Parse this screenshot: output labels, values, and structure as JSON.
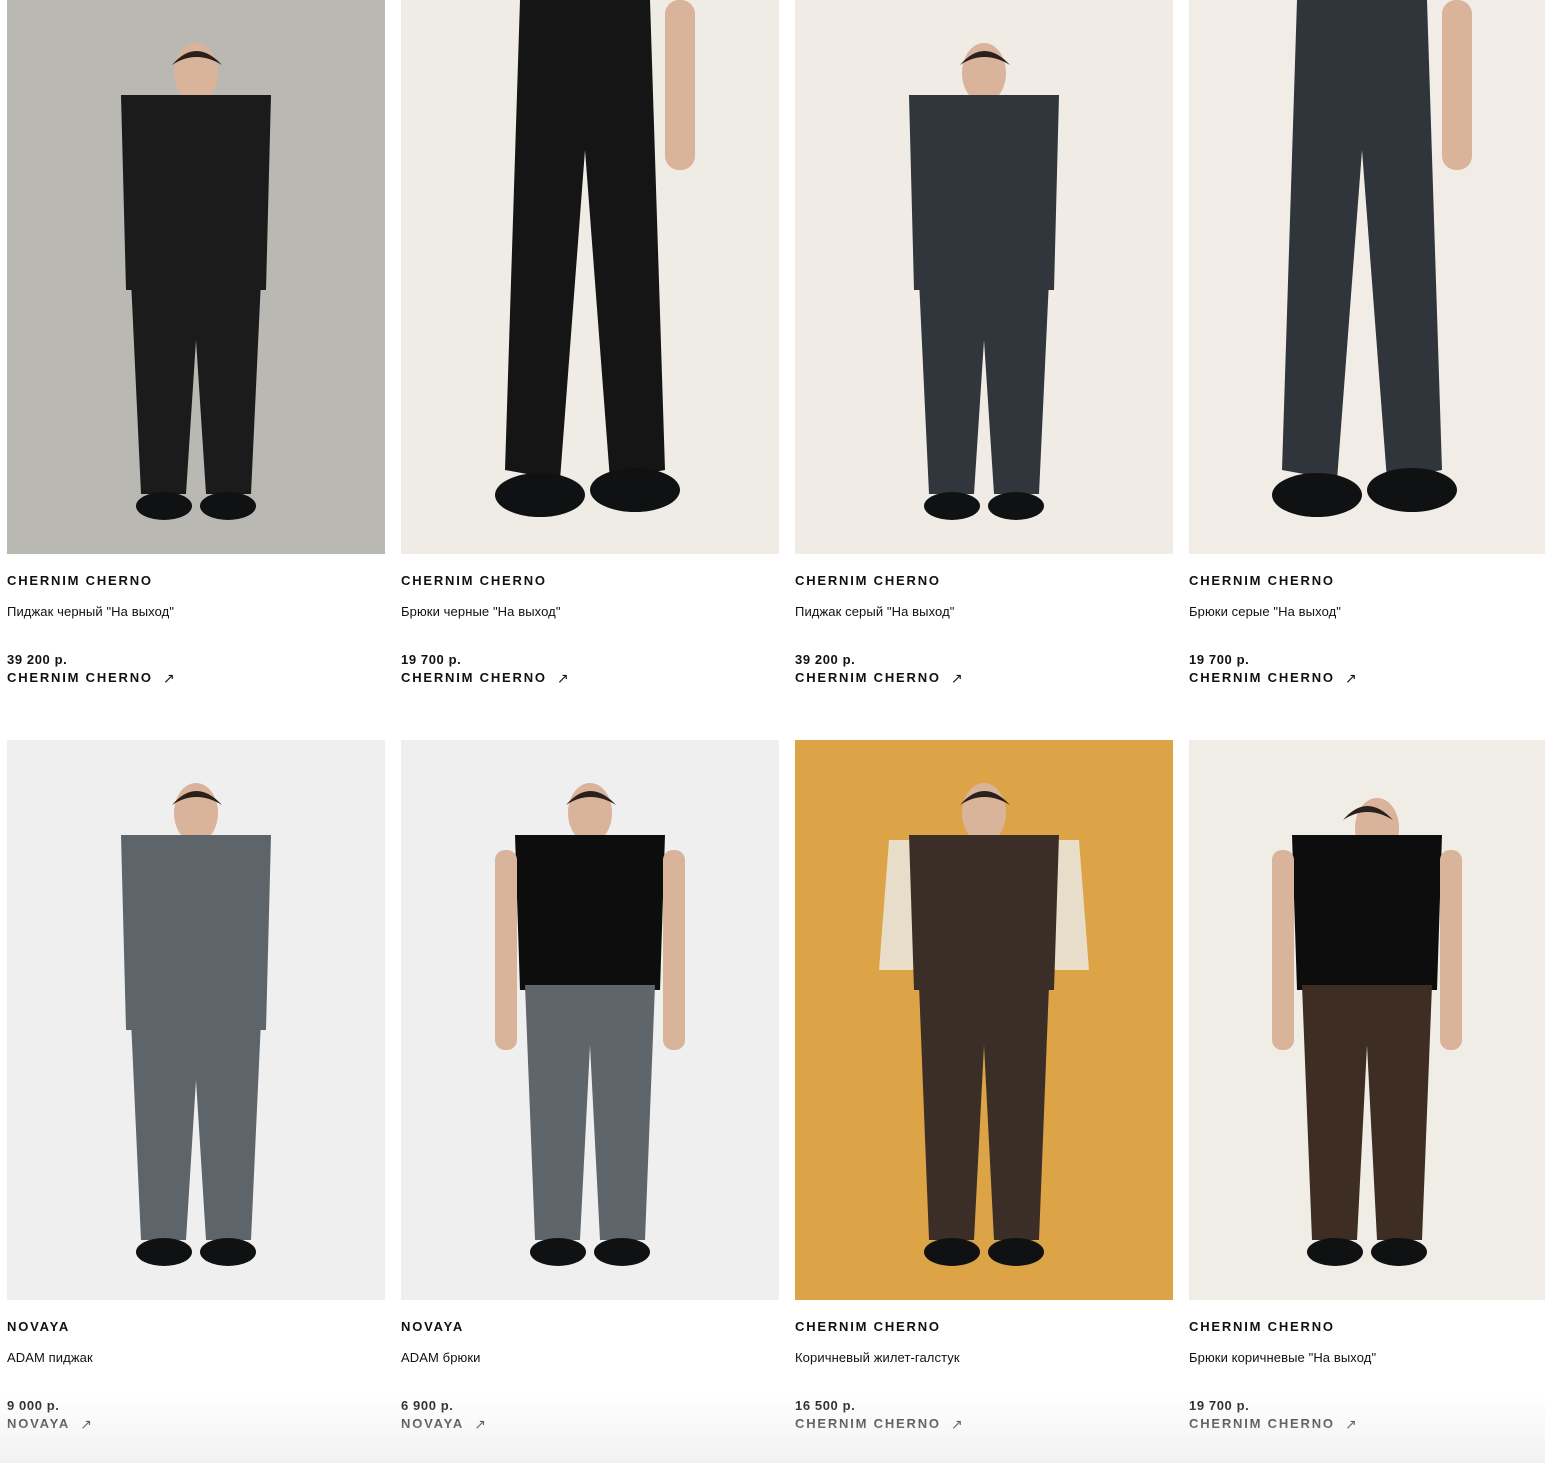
{
  "products": [
    {
      "brand": "CHERNIM CHERNO",
      "title": "Пиджак черный \"На выход\"",
      "price": "39 200 р.",
      "shop": "CHERNIM CHERNO",
      "bg": "#b9b8b2",
      "garment": "#1b1b1c",
      "kind": "full-suit"
    },
    {
      "brand": "CHERNIM CHERNO",
      "title": "Брюки черные \"На выход\"",
      "price": "19 700 р.",
      "shop": "CHERNIM CHERNO",
      "bg": "#efece6",
      "garment": "#151516",
      "kind": "pants"
    },
    {
      "brand": "CHERNIM CHERNO",
      "title": "Пиджак серый \"На выход\"",
      "price": "39 200 р.",
      "shop": "CHERNIM CHERNO",
      "bg": "#f0ece5",
      "garment": "#30363c",
      "kind": "full-suit"
    },
    {
      "brand": "CHERNIM CHERNO",
      "title": "Брюки серые \"На выход\"",
      "price": "19 700 р.",
      "shop": "CHERNIM CHERNO",
      "bg": "#f1ede6",
      "garment": "#2f353b",
      "kind": "pants"
    },
    {
      "brand": "NOVAYA",
      "title": "ADAM пиджак",
      "price": "9 000 р.",
      "shop": "NOVAYA",
      "bg": "#efefef",
      "garment": "#5d646a",
      "kind": "full-suit"
    },
    {
      "brand": "NOVAYA",
      "title": "ADAM брюки",
      "price": "6 900 р.",
      "shop": "NOVAYA",
      "bg": "#efefef",
      "garment": "#5e656b",
      "kind": "tank"
    },
    {
      "brand": "CHERNIM CHERNO",
      "title": "Коричневый жилет-галстук",
      "price": "16 500 р.",
      "shop": "CHERNIM CHERNO",
      "bg": "#dca446",
      "garment": "#3a2e27",
      "kind": "vest"
    },
    {
      "brand": "CHERNIM CHERNO",
      "title": "Брюки коричневые \"На выход\"",
      "price": "19 700 р.",
      "shop": "CHERNIM CHERNO",
      "bg": "#f0ede7",
      "garment": "#3d2d22",
      "kind": "tee"
    }
  ],
  "icons": {
    "external_link": "arrow-up-right-icon",
    "arrow_glyph": "↗"
  }
}
